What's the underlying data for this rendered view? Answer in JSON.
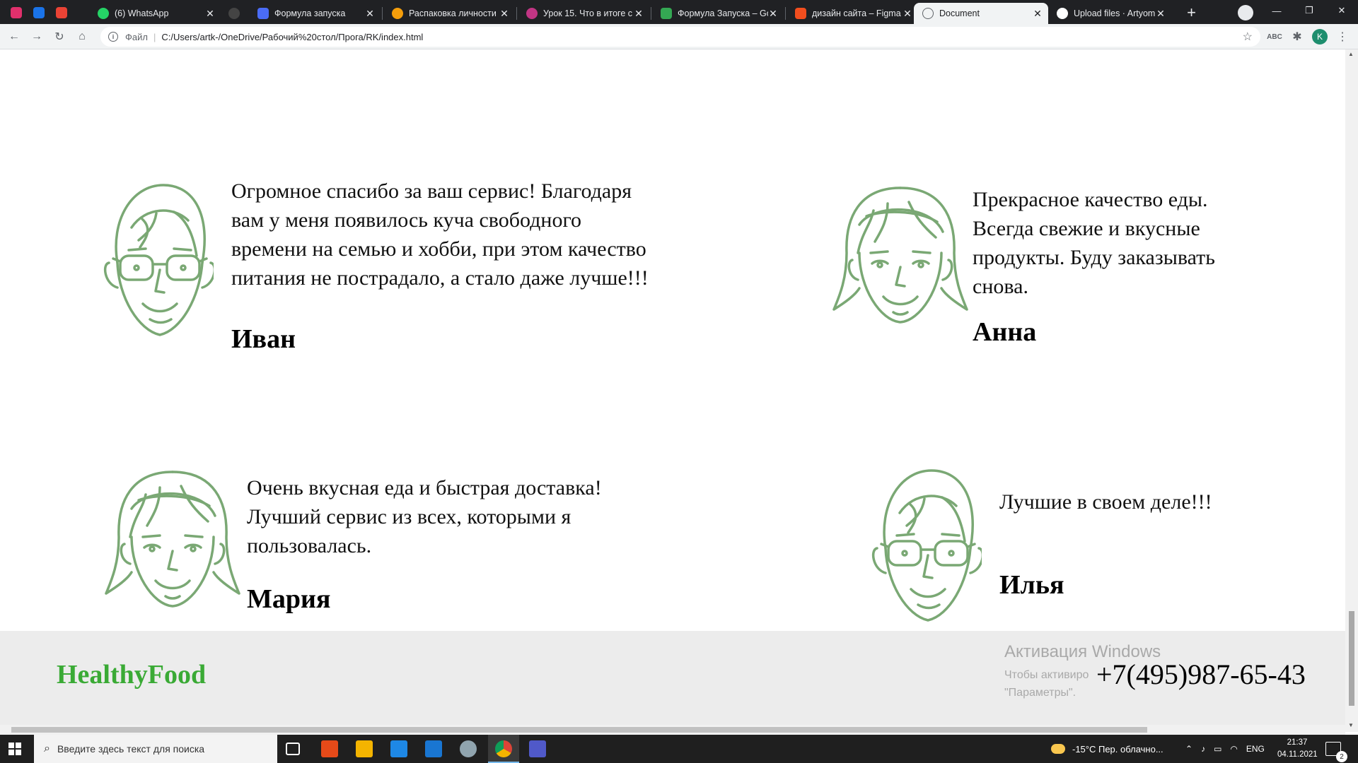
{
  "browser": {
    "pinned_tabs": [
      {
        "icon": "instagram-icon",
        "color": "#e1306c"
      },
      {
        "icon": "messenger-icon",
        "color": "#1a73e8"
      },
      {
        "icon": "gmail-icon",
        "color": "#ea4335"
      }
    ],
    "tabs": [
      {
        "title": "(6) WhatsApp",
        "icon": "whatsapp-icon",
        "color": "#25d366"
      },
      {
        "title": "",
        "icon": "generic-icon",
        "color": "#444444"
      },
      {
        "title": "Формула запуска",
        "icon": "rocket-icon",
        "color": "#4a6cf7"
      },
      {
        "title": "Распаковка личности",
        "icon": "heart-icon",
        "color": "#f59e0b"
      },
      {
        "title": "Урок 15. Что в итоге с",
        "icon": "instagram-icon",
        "color": "#c13584"
      },
      {
        "title": "Формула Запуска – Go",
        "icon": "google-drive-icon",
        "color": "#34a853"
      },
      {
        "title": "дизайн сайта – Figma",
        "icon": "figma-icon",
        "color": "#f24e1e"
      },
      {
        "title": "Document",
        "icon": "globe-icon",
        "color": "#5f6368",
        "active": true
      },
      {
        "title": "Upload files · ArtyomK",
        "icon": "github-icon",
        "color": "#ffffff"
      }
    ],
    "address": {
      "scheme_label": "Файл",
      "url": "C:/Users/artk-/OneDrive/Рабочий%20стол/Прога/RK/index.html"
    },
    "profile_initial": "K"
  },
  "page": {
    "reviews": [
      {
        "text": "Огромное спасибо за ваш сервис! Благодаря вам у меня появилось куча свободного времени на семью и хобби, при этом качество питания не пострадало, а стало даже лучше!!!",
        "name": "Иван",
        "avatar": "man-face-icon"
      },
      {
        "text": "Прекрасное качество еды. Всегда свежие и вкусные продукты. Буду заказывать снова.",
        "name": "Анна",
        "avatar": "woman-face-icon"
      },
      {
        "text": "Очень вкусная еда и быстрая доставка! Лучший сервис из всех, которыми я пользовалась.",
        "name": "Мария",
        "avatar": "woman-face-icon"
      },
      {
        "text": "Лучшие в своем деле!!!",
        "name": "Илья",
        "avatar": "man-face-icon"
      }
    ],
    "footer": {
      "logo": "HealthyFood",
      "phone": "+7(495)987-65-43"
    },
    "watermark": {
      "title": "Активация Windows",
      "line1": "Чтобы активиро",
      "line2": "\"Параметры\"."
    },
    "face_color": "#7aa874"
  },
  "taskbar": {
    "search_placeholder": "Введите здесь текст для поиска",
    "weather": "-15°C  Пер. облачно...",
    "language": "ENG",
    "time": "21:37",
    "date": "04.11.2021",
    "notifications": "2"
  }
}
